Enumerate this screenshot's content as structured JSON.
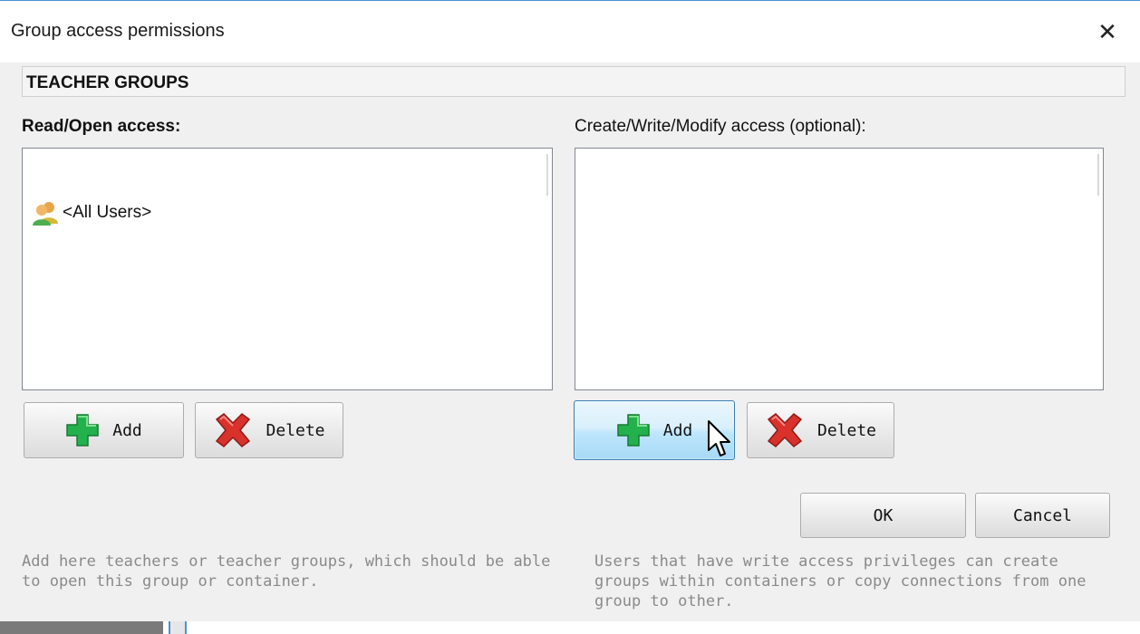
{
  "window": {
    "title": "Group access permissions",
    "close_icon": "close-icon"
  },
  "section": {
    "title": "TEACHER GROUPS"
  },
  "read_access": {
    "label": "Read/Open access:",
    "items": [
      {
        "icon": "users-group-icon",
        "label": "<All Users>"
      }
    ],
    "add_label": "Add",
    "delete_label": "Delete",
    "help_text": "Add here teachers or teacher groups, which should be able to open this group or container."
  },
  "write_access": {
    "label": "Create/Write/Modify access (optional):",
    "items": [],
    "add_label": "Add",
    "delete_label": "Delete",
    "help_text": "Users that have write access privileges can create groups within containers or copy connections from one group to other."
  },
  "footer": {
    "ok_label": "OK",
    "cancel_label": "Cancel"
  },
  "colors": {
    "add_icon": "#22b14c",
    "delete_icon": "#d9312b",
    "accent": "#3c7fb1"
  }
}
